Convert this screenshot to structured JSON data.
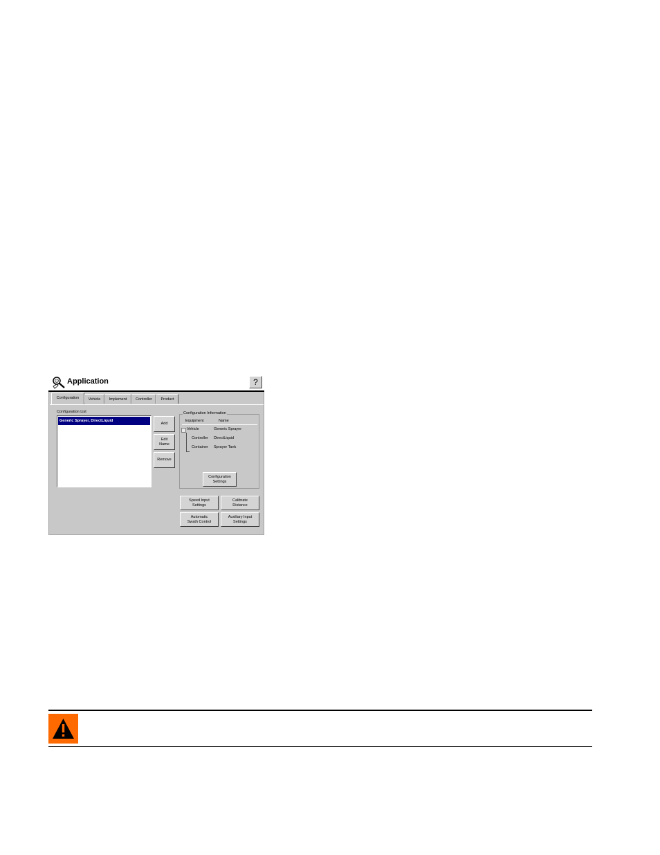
{
  "window": {
    "title": "Application",
    "help_label": "?"
  },
  "tabs": [
    {
      "label": "Configuration",
      "active": true
    },
    {
      "label": "Vehicle",
      "active": false
    },
    {
      "label": "Implement",
      "active": false
    },
    {
      "label": "Controller",
      "active": false
    },
    {
      "label": "Product",
      "active": false
    }
  ],
  "config_list": {
    "label": "Configuration List",
    "items": [
      "Generic Sprayer, DirectLiquid"
    ],
    "selected_index": 0
  },
  "list_buttons": {
    "add": "Add",
    "edit_name": "Edit\nName",
    "remove": "Remove"
  },
  "config_info": {
    "title": "Configuration Information",
    "columns": [
      "Equipment",
      "Name"
    ],
    "rows": [
      {
        "equipment": "Vehicle",
        "name": "Generic Sprayer"
      },
      {
        "equipment": "Controller",
        "name": "DirectLiquid"
      },
      {
        "equipment": "Container",
        "name": "Sprayer Tank"
      }
    ],
    "settings_button": "Configuration\nSettings"
  },
  "bottom_buttons": {
    "speed_input": "Speed Input\nSettings",
    "calibrate_distance": "Calibrate\nDistance",
    "automatic_swath": "Automatic\nSwath Control",
    "auxiliary_input": "Auxiliary Input\nSettings"
  },
  "icons": {
    "title": "wrench-magnifier-icon",
    "warning": "warning-icon",
    "tree_collapse": "tree-collapse-icon"
  },
  "colors": {
    "selection": "#000080",
    "window_face": "#c8c8c8",
    "warning": "#ff6a00"
  }
}
